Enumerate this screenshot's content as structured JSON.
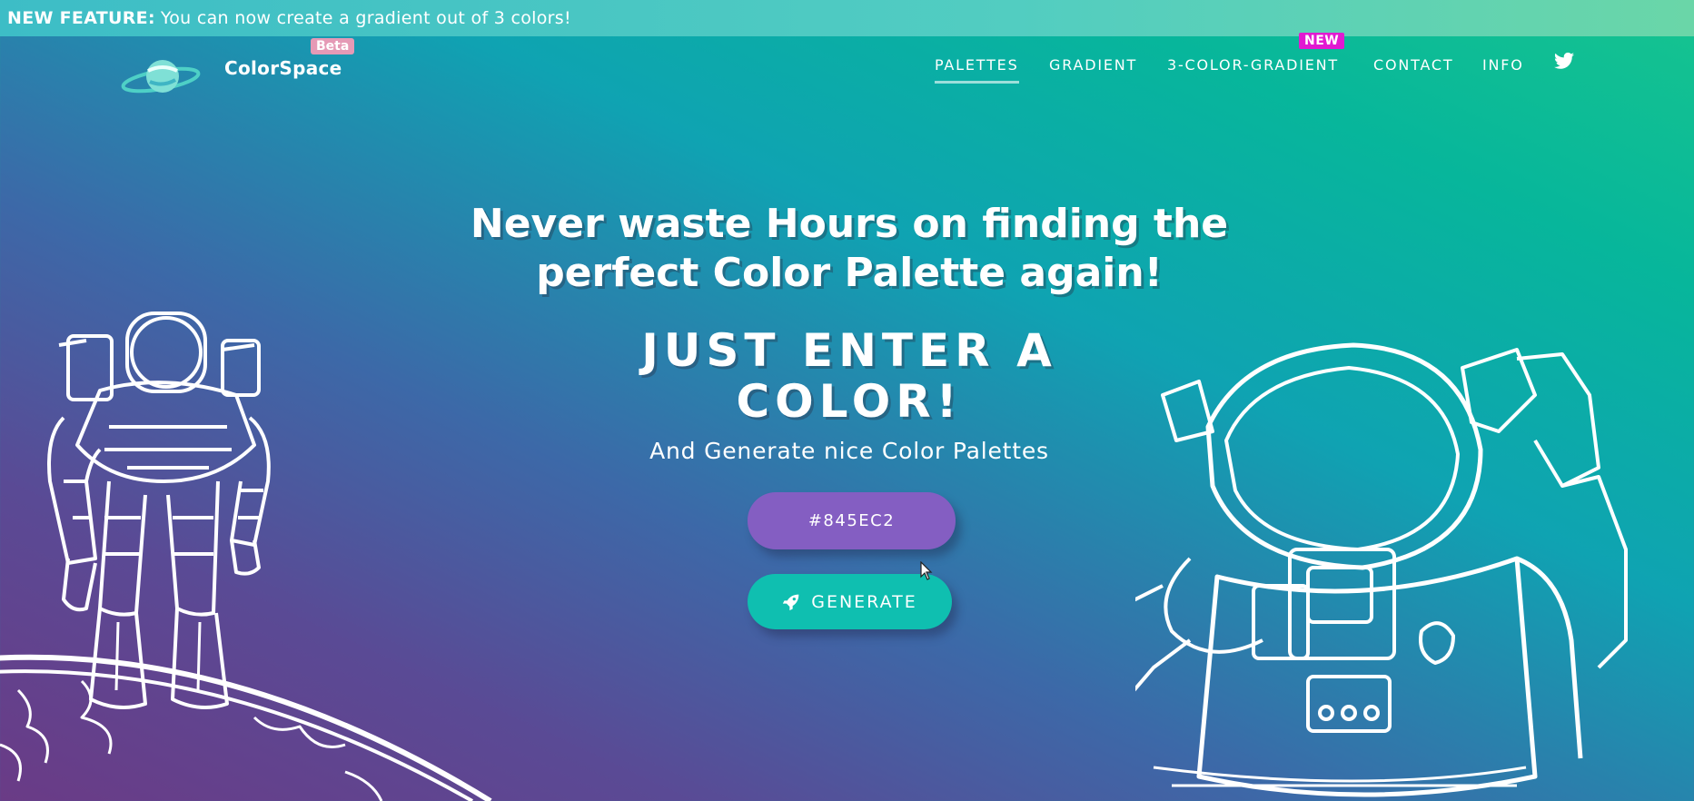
{
  "banner": {
    "label": "NEW FEATURE:",
    "text": "You can now create a gradient out of 3 colors!"
  },
  "brand": {
    "name": "ColorSpace",
    "badge": "Beta"
  },
  "nav": {
    "items": [
      {
        "label": "PALETTES",
        "active": true
      },
      {
        "label": "GRADIENT"
      },
      {
        "label": "3-COLOR-GRADIENT"
      },
      {
        "label": "CONTACT"
      },
      {
        "label": "INFO"
      }
    ],
    "new_badge": "NEW",
    "social_icon": "twitter-icon"
  },
  "hero": {
    "headline_line1": "Never waste Hours on finding the",
    "headline_line2": "perfect Color Palette again!",
    "big_line1": "JUST ENTER A",
    "big_line2": "COLOR!",
    "subtitle": "And Generate nice Color Palettes"
  },
  "input": {
    "value": "#845EC2",
    "color": "#845ec2"
  },
  "generate": {
    "label": "GENERATE",
    "icon": "rocket-icon",
    "color": "#0fbfb0"
  }
}
